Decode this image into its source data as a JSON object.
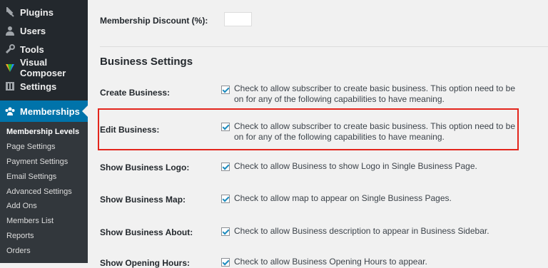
{
  "sidebar": {
    "menu": [
      {
        "label": "Plugins",
        "icon": "plugin-icon"
      },
      {
        "label": "Users",
        "icon": "user-icon"
      },
      {
        "label": "Tools",
        "icon": "wrench-icon"
      },
      {
        "label": "Visual Composer",
        "icon": "visual-composer-icon"
      },
      {
        "label": "Settings",
        "icon": "settings-icon"
      },
      {
        "label": "Memberships",
        "icon": "people-icon"
      }
    ],
    "submenu": [
      {
        "label": "Membership Levels"
      },
      {
        "label": "Page Settings"
      },
      {
        "label": "Payment Settings"
      },
      {
        "label": "Email Settings"
      },
      {
        "label": "Advanced Settings"
      },
      {
        "label": "Add Ons"
      },
      {
        "label": "Members List"
      },
      {
        "label": "Reports"
      },
      {
        "label": "Orders"
      }
    ]
  },
  "main": {
    "membership_discount_label": "Membership Discount (%):",
    "membership_discount_value": "",
    "section_title": "Business Settings",
    "rows": [
      {
        "label": "Create Business:",
        "checked": true,
        "desc": "Check to allow subscriber to create basic business. This option need to be on for any of the following capabilities to have meaning."
      },
      {
        "label": "Edit Business:",
        "checked": true,
        "desc": "Check to allow subscriber to create basic business. This option need to be on for any of the following capabilities to have meaning."
      },
      {
        "label": "Show Business Logo:",
        "checked": true,
        "desc": "Check to allow Business to show Logo in Single Business Page."
      },
      {
        "label": "Show Business Map:",
        "checked": true,
        "desc": "Check to allow map to appear on Single Business Pages."
      },
      {
        "label": "Show Business About:",
        "checked": true,
        "desc": "Check to allow Business description to appear in Business Sidebar."
      },
      {
        "label": "Show Opening Hours:",
        "checked": true,
        "desc": "Check to allow Business Opening Hours to appear."
      }
    ]
  },
  "colors": {
    "highlight": "#e3251c",
    "active_menu": "#0073aa",
    "sidebar": "#23282d"
  }
}
